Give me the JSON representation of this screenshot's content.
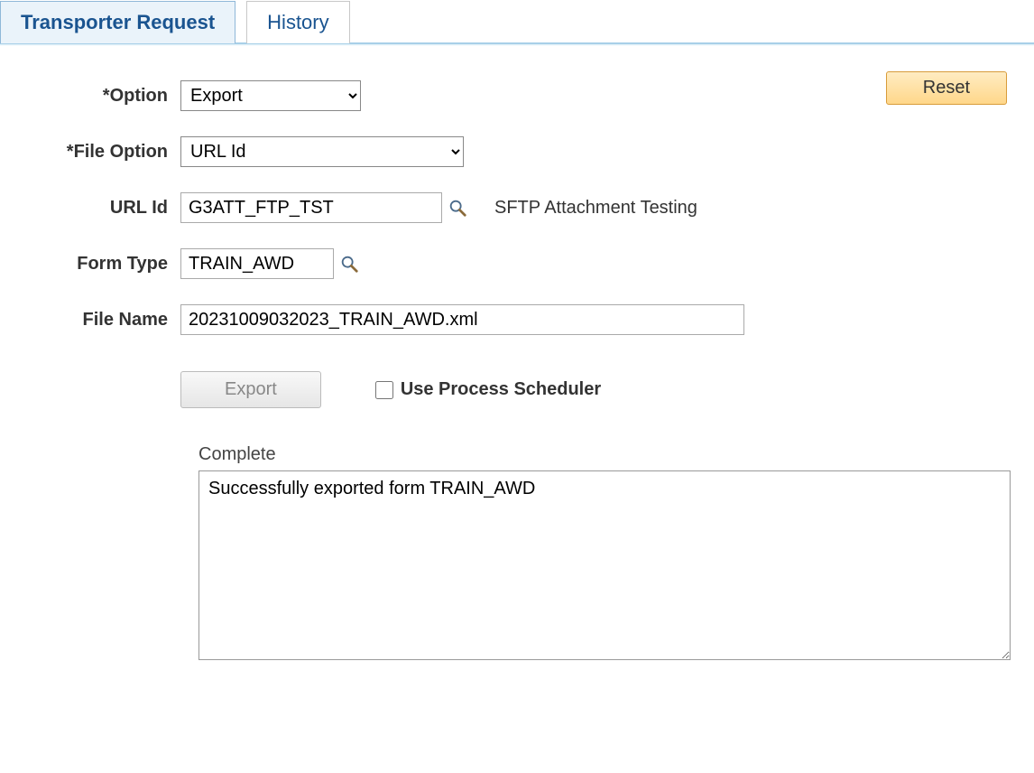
{
  "tabs": {
    "transporter_request": "Transporter Request",
    "history": "History"
  },
  "buttons": {
    "reset": "Reset",
    "export": "Export"
  },
  "labels": {
    "option": "*Option",
    "file_option": "*File Option",
    "url_id": "URL Id",
    "form_type": "Form Type",
    "file_name": "File Name",
    "use_process_scheduler": "Use Process Scheduler",
    "status": "Complete"
  },
  "fields": {
    "option_value": "Export",
    "file_option_value": "URL Id",
    "url_id_value": "G3ATT_FTP_TST",
    "url_id_description": "SFTP Attachment Testing",
    "form_type_value": "TRAIN_AWD",
    "file_name_value": "20231009032023_TRAIN_AWD.xml",
    "use_process_scheduler_checked": false,
    "status_message": "Successfully exported form TRAIN_AWD"
  }
}
